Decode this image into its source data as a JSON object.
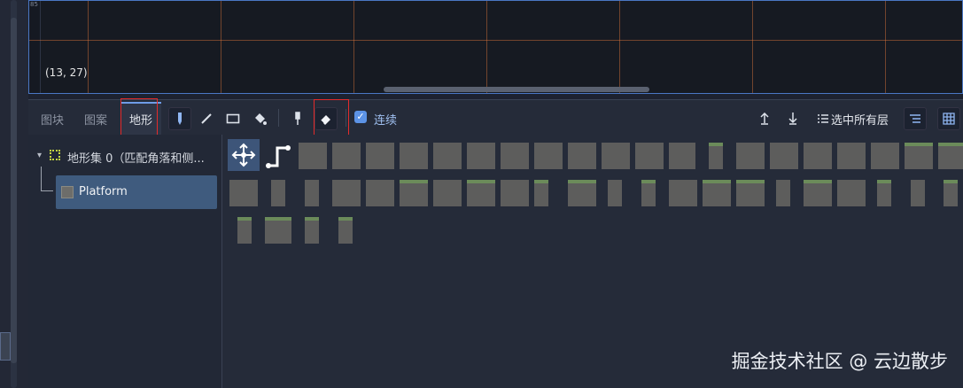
{
  "viewport": {
    "coordinate": "(13, 27)",
    "ruler_label": "85"
  },
  "toolbar": {
    "tabs": [
      {
        "label": "图块"
      },
      {
        "label": "图案"
      },
      {
        "label": "地形",
        "active": true
      }
    ],
    "tools": [
      "pencil-icon",
      "line-icon",
      "rect-icon",
      "bucket-icon",
      "picker-icon",
      "eraser-icon"
    ],
    "continuous_label": "连续",
    "continuous_checked": true,
    "select_all_layers_label": "选中所有层"
  },
  "tree": {
    "terrain_set_label": "地形集 0（匹配角落和侧...",
    "terrain_item_label": "Platform"
  },
  "watermark": "掘金技术社区 @ 云边散步",
  "colors": {
    "accent": "#5c93e6",
    "highlight_box": "#e32b2b",
    "selected_row": "#3f5b7e"
  }
}
